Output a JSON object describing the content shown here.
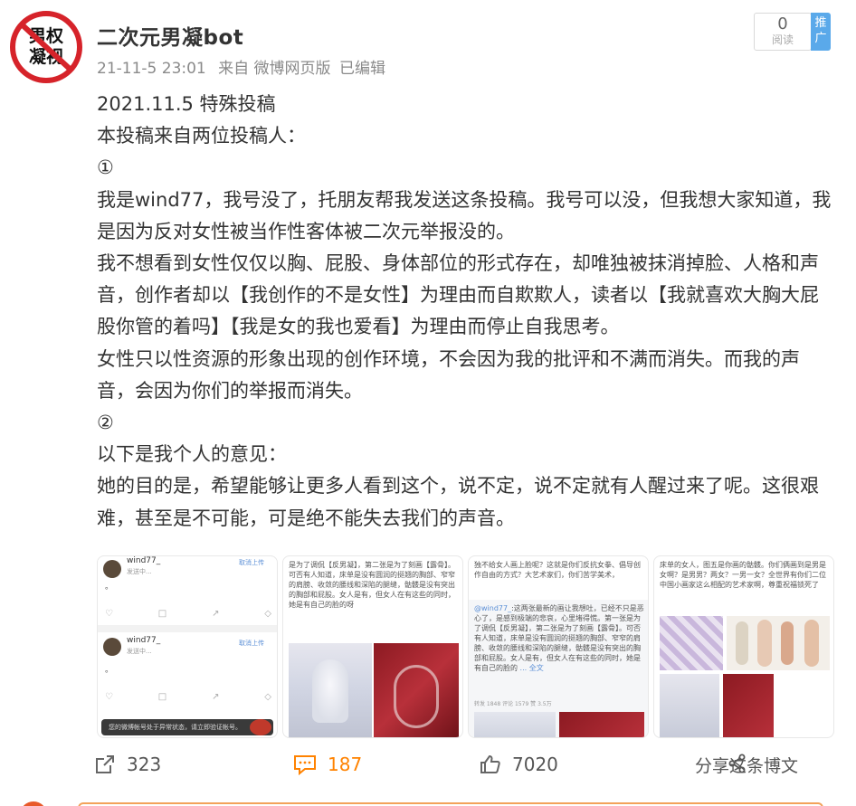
{
  "post": {
    "username": "二次元男凝bot",
    "avatar_text_line1": "男权",
    "avatar_text_line2": "凝视",
    "timestamp": "21-11-5 23:01",
    "source": "来自 微博网页版",
    "edited": "已编辑",
    "read_count": "0",
    "read_label": "阅读",
    "promote_label": "推广",
    "paragraphs": [
      "2021.11.5 特殊投稿",
      "本投稿来自两位投稿人：",
      "①",
      "我是wind77，我号没了，托朋友帮我发送这条投稿。我号可以没，但我想大家知道，我是因为反对女性被当作性客体被二次元举报没的。",
      "我不想看到女性仅仅以胸、屁股、身体部位的形式存在，却唯独被抹消掉脸、人格和声音，创作者却以【我创作的不是女性】为理由而自欺欺人，读者以【我就喜欢大胸大屁股你管的着吗】【我是女的我也爱看】为理由而停止自我思考。",
      "女性只以性资源的形象出现的创作环境，不会因为我的批评和不满而消失。而我的声音，会因为你们的举报而消失。",
      "②",
      "以下是我个人的意见：",
      "她的目的是，希望能够让更多人看到这个，说不定，说不定就有人醒过来了呢。这很艰难，甚至是不可能，可是绝不能失去我们的声音。"
    ]
  },
  "thumbnails": {
    "t1": {
      "user1": "wind77_",
      "status1": "发送中...",
      "cancel1": "取消上传",
      "user2": "wind77_",
      "status2": "发送中...",
      "cancel2": "取消上传",
      "dot": "。",
      "banner": "您的微博帐号处于异常状态，请立即验证帐号。"
    },
    "t2": {
      "text": "是为了调侃【反男凝】，第二张是为了刻画【露骨】。可否有人知道，床单是没有圆润的挺翘的胸部、窄窄的肩膀、收敛的腰线和深陷的腿缝，骷髅是没有突出的胸部和屁股。女人是有，但女人在有这些的同时，她是有自己的脸的呀"
    },
    "t3": {
      "text_top": "独不给女人画上脸呢？这就是你们反抗女拳、倡导创作自由的方式？大艺术家们，你们苦学美术，",
      "mention": "@wind77_",
      "text_main": ":这两张最新的画让我想吐，已经不只是恶心了，是感到极端的悲哀，心里堵得慌。第一张是为了调侃【反男凝】，第二张是为了刻画【露骨】。可否有人知道，床单是没有圆润的挺翘的胸部、窄窄的肩膀、收敛的腰线和深陷的腿缝，骷髅是没有突出的胸部和屁股。女人是有，但女人在有这些的同时，她是有自己的脸的",
      "more": "... 全文",
      "stats": "转发 1848    评论 1579    赞 3.5万"
    },
    "t4": {
      "text": "床单的女人，图五是你画的骷髅。你们俩画到是男是女啊？是男男？两女？一男一女？全世界有你们二位中国小画家这么相配的艺术家啊，尊重祝福锁死了"
    }
  },
  "actions": {
    "repost_count": "323",
    "comment_count": "187",
    "like_count": "7020",
    "share_label": "分享这条博文"
  },
  "colors": {
    "accent_orange": "#ff8200",
    "promote_blue": "#5aa9ea",
    "meta_gray": "#8a8a8a",
    "avatar_red": "#d6232a"
  },
  "icons": [
    "repost-icon",
    "comment-icon",
    "like-icon",
    "share-icon",
    "avatar-prohibition-icon"
  ]
}
